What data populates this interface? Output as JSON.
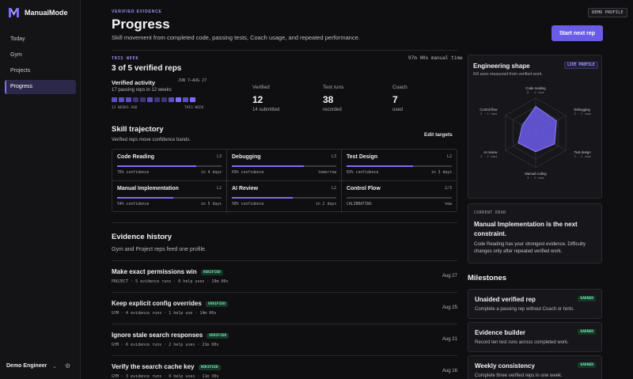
{
  "app": {
    "name": "ManualMode",
    "accent": "#7b6dff"
  },
  "sidebar": {
    "items": [
      {
        "label": "Today"
      },
      {
        "label": "Gym"
      },
      {
        "label": "Projects"
      },
      {
        "label": "Progress",
        "active": true
      }
    ],
    "user": "Demo Engineer",
    "user_chevron_icon": "chevron-down-icon",
    "settings_icon": "gear-icon"
  },
  "header": {
    "kicker": "VERIFIED EVIDENCE",
    "title": "Progress",
    "subtitle": "Skill movement from completed code, passing tests, Coach usage, and repeated performance.",
    "demo_badge": "DEMO PROFILE",
    "start_button": "Start next rep"
  },
  "this_week": {
    "kicker": "THIS WEEK",
    "manual_time": "97m 00s manual time",
    "title": "3 of 5 verified reps",
    "activity": {
      "title": "Verified activity",
      "range": "JUN 7–AUG 27",
      "subtitle": "17 passing reps in 12 weeks",
      "weeks": [
        2,
        2,
        2,
        1,
        1,
        2,
        1,
        1,
        2,
        3,
        2,
        3
      ],
      "label_left": "12 WEEKS AGO",
      "label_right": "THIS WEEK"
    },
    "stats": [
      {
        "label": "Verified",
        "value": "12",
        "sub": "14 submitted"
      },
      {
        "label": "Test runs",
        "value": "38",
        "sub": "recorded"
      },
      {
        "label": "Coach",
        "value": "7",
        "sub": "used"
      }
    ]
  },
  "trajectory": {
    "title": "Skill trajectory",
    "subtitle": "Verified reps move confidence bands.",
    "edit_label": "Edit targets",
    "skills": [
      {
        "name": "Code Reading",
        "level": "L3",
        "confidence": 76,
        "conf_label": "76% confidence",
        "when": "in 4 days"
      },
      {
        "name": "Debugging",
        "level": "L3",
        "confidence": 69,
        "conf_label": "69% confidence",
        "when": "tomorrow"
      },
      {
        "name": "Test Design",
        "level": "L2",
        "confidence": 63,
        "conf_label": "63% confidence",
        "when": "in 3 days"
      },
      {
        "name": "Manual Implementation",
        "level": "L2",
        "confidence": 54,
        "conf_label": "54% confidence",
        "when": "in 5 days"
      },
      {
        "name": "AI Review",
        "level": "L2",
        "confidence": 58,
        "conf_label": "58% confidence",
        "when": "in 2 days"
      },
      {
        "name": "Control Flow",
        "level": "2/3",
        "confidence": 0,
        "conf_label": "CALIBRATING",
        "when": "now"
      }
    ]
  },
  "evidence": {
    "title": "Evidence history",
    "subtitle": "Gym and Project reps feed one profile.",
    "items": [
      {
        "title": "Make exact permissions win",
        "badge": "VERIFIED",
        "meta": "PROJECT · 5 evidence runs · 0 help uses · 19m 00s",
        "date": "Aug 27"
      },
      {
        "title": "Keep explicit config overrides",
        "badge": "VERIFIED",
        "meta": "GYM · 4 evidence runs · 1 help use · 14m 00s",
        "date": "Aug 25"
      },
      {
        "title": "Ignore stale search responses",
        "badge": "VERIFIED",
        "meta": "GYM · 6 evidence runs · 2 help uses · 21m 00s",
        "date": "Aug 21"
      },
      {
        "title": "Verify the search cache key",
        "badge": "VERIFIED",
        "meta": "GYM · 3 evidence runs · 0 help uses · 11m 30s",
        "date": "Aug 16"
      }
    ]
  },
  "engineering_shape": {
    "title": "Engineering shape",
    "badge": "LIVE PROFILE",
    "subtitle": "6/6 axes measured from verified work.",
    "axes": [
      {
        "label": "Code reading",
        "reps": "8 · 4 reps",
        "value": 0.76
      },
      {
        "label": "Debugging",
        "reps": "3 · 2 reps",
        "value": 0.69
      },
      {
        "label": "Test design",
        "reps": "3 · 2 reps",
        "value": 0.63
      },
      {
        "label": "Manual coding",
        "reps": "3 · 2 reps",
        "value": 0.54
      },
      {
        "label": "AI review",
        "reps": "3 · 2 reps",
        "value": 0.58
      },
      {
        "label": "Control flow",
        "reps": "3 · 2 reps",
        "value": 0.44
      }
    ],
    "fill": "#6b5ce7"
  },
  "current_read": {
    "kicker": "CURRENT READ",
    "title": "Manual Implementation is the next constraint.",
    "body": "Code Reading has your strongest evidence. Difficulty changes only after repeated verified work."
  },
  "milestones": {
    "title": "Milestones",
    "items": [
      {
        "name": "Unaided verified rep",
        "badge": "EARNED",
        "desc": "Complete a passing rep without Coach or hints."
      },
      {
        "name": "Evidence builder",
        "badge": "EARNED",
        "desc": "Record ten test runs across completed work."
      },
      {
        "name": "Weekly consistency",
        "badge": "EARNED",
        "desc": "Complete three verified reps in one week."
      }
    ]
  }
}
